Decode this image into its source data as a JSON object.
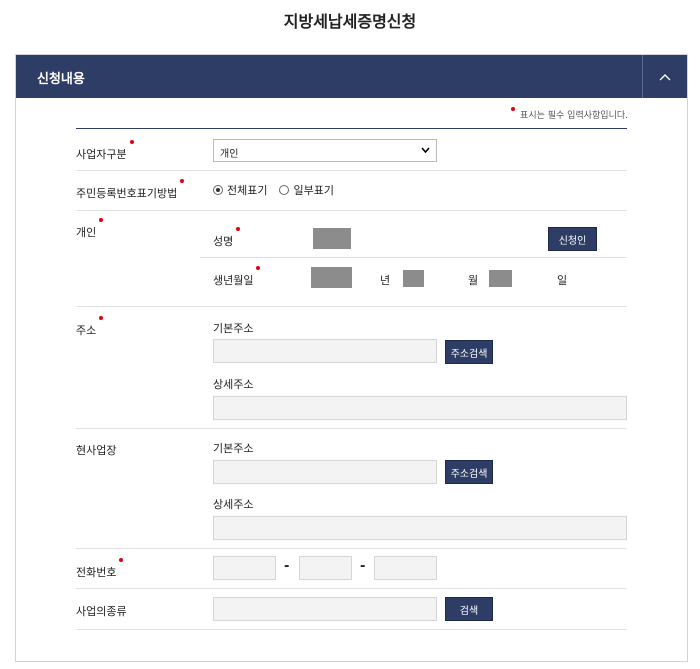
{
  "page": {
    "title": "지방세납세증명신청"
  },
  "panel": {
    "title": "신청내용"
  },
  "notice": "표시는 필수 입력사항입니다.",
  "fields": {
    "business_type": {
      "label": "사업자구분",
      "selected": "개인"
    },
    "rrn_display": {
      "label": "주민등록번호표기방법",
      "options": [
        "전체표기",
        "일부표기"
      ],
      "selected": "전체표기"
    },
    "individual": {
      "label": "개인",
      "name_label": "성명",
      "applicant_button": "신청인",
      "birth_label": "생년월일",
      "year_unit": "년",
      "month_unit": "월",
      "day_unit": "일"
    },
    "address": {
      "label": "주소",
      "basic_label": "기본주소",
      "search_button": "주소검색",
      "detail_label": "상세주소"
    },
    "workplace": {
      "label": "현사업장",
      "basic_label": "기본주소",
      "search_button": "주소검색",
      "detail_label": "상세주소"
    },
    "phone": {
      "label": "전화번호",
      "separator": "-"
    },
    "business_category": {
      "label": "사업의종류",
      "search_button": "검색"
    }
  },
  "colors": {
    "header_navy": "#2d3d66",
    "required_red": "#e60012"
  }
}
